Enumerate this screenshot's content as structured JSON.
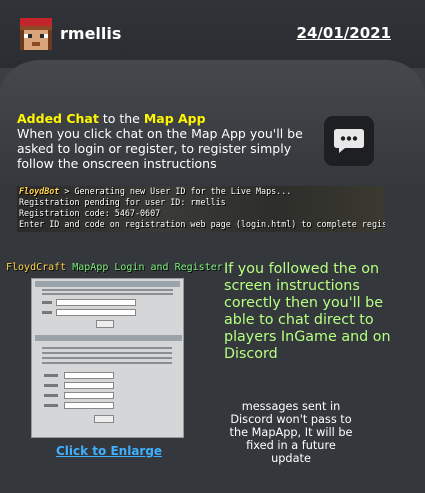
{
  "header": {
    "username": "rmellis",
    "date": "24/01/2021",
    "avatar_icon": "minecraft-avatar-icon"
  },
  "announcement": {
    "title_part1": "Added Chat",
    "title_part2": " to the ",
    "title_part3": "Map App",
    "body": "When you click chat on the Map App you'll be asked to login or register, to register simply follow the onscreen instructions"
  },
  "chat_button": {
    "icon": "chat-bubble-icon"
  },
  "console": {
    "bot_name": "FloydBot",
    "line1_rest": " > Generating new User ID for the Live Maps...",
    "line2": "Registration pending for user ID: rmellis",
    "line3": "Registration code: 5467-0607",
    "line4": "Enter ID and code on registration web page (login.html) to complete registration"
  },
  "screenshot": {
    "title_part1": "FloydCraft",
    "title_part2": " MapApp Login and Register",
    "link": "Click to Enlarge"
  },
  "instructions": "If you followed the on screen instructions corectly then you'll be able to chat direct to players InGame and on Discord",
  "note": "messages sent in Discord won't pass to the MapApp, It will be fixed in a future update",
  "colors": {
    "highlight": "#fff700",
    "link": "#3fb0ff",
    "instructions": "#b6ff82",
    "background": "#34373b"
  }
}
